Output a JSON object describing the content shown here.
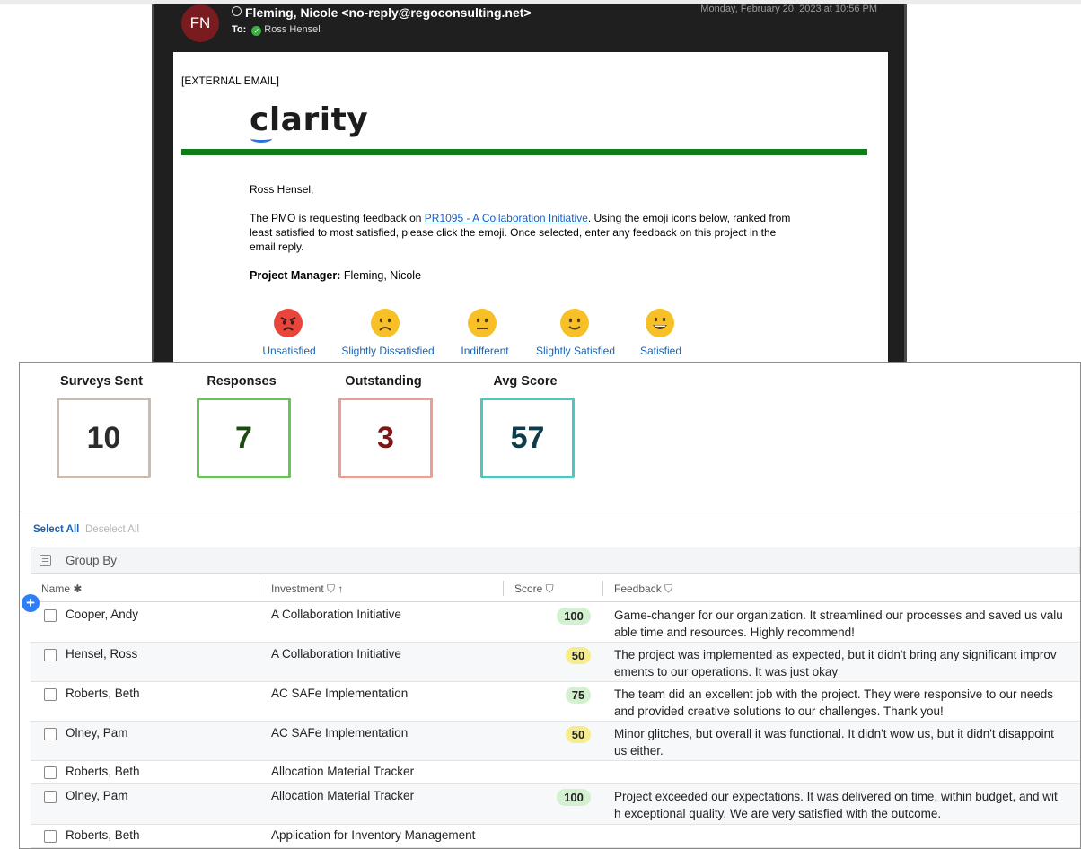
{
  "email": {
    "avatar_initials": "FN",
    "from": "Fleming, Nicole <no-reply@regoconsulting.net>",
    "to_label": "To:",
    "to_name": "Ross Hensel",
    "date": "Monday, February 20, 2023 at 10:56 PM",
    "external_tag": "[EXTERNAL EMAIL]",
    "logo_text": "clarity",
    "greeting": "Ross Hensel,",
    "body_pre": "The PMO is requesting feedback on ",
    "body_link": "PR1095 - A Collaboration Initiative",
    "body_post": ". Using the emoji icons below, ranked from least satisfied to most satisfied, please click the emoji. Once selected, enter any feedback on this project in the email reply.",
    "pm_label": "Project Manager:",
    "pm_value": " Fleming, Nicole",
    "emojis": [
      {
        "label": "Unsatisfied",
        "icon": "angry-face-icon",
        "color": "#e8453c"
      },
      {
        "label": "Slightly Dissatisfied",
        "icon": "frowning-face-icon",
        "color": "#f6c026"
      },
      {
        "label": "Indifferent",
        "icon": "neutral-face-icon",
        "color": "#f6c026"
      },
      {
        "label": "Slightly Satisfied",
        "icon": "slightly-smiling-face-icon",
        "color": "#f6c026"
      },
      {
        "label": "Satisfied",
        "icon": "grinning-face-icon",
        "color": "#f6c026"
      }
    ]
  },
  "kpis": [
    {
      "label": "Surveys Sent",
      "value": "10",
      "border": "#c9bcaf",
      "color": "#2b2b2b"
    },
    {
      "label": "Responses",
      "value": "7",
      "border": "#6cc25a",
      "color": "#1d4a12"
    },
    {
      "label": "Outstanding",
      "value": "3",
      "border": "#e8a096",
      "color": "#7d1616"
    },
    {
      "label": "Avg Score",
      "value": "57",
      "border": "#4fc7c0",
      "color": "#0e3c4a"
    }
  ],
  "grid": {
    "select_all": "Select All",
    "deselect_all": "Deselect All",
    "group_by": "Group By",
    "columns": {
      "name": "Name ✱",
      "investment": "Investment ⛉ ↑",
      "score": "Score ⛉",
      "feedback": "Feedback ⛉"
    },
    "rows": [
      {
        "name": "Cooper, Andy",
        "investment": "A Collaboration Initiative",
        "score": "100",
        "score_color": "#d3f0d1",
        "feedback": "Game-changer for our organization. It streamlined our processes and saved us valuable time and resources. Highly recommend!"
      },
      {
        "name": "Hensel, Ross",
        "investment": "A Collaboration Initiative",
        "score": "50",
        "score_color": "#f6ec8e",
        "feedback": "The project was implemented as expected, but it didn't bring any significant improvements to our operations. It was just okay"
      },
      {
        "name": "Roberts, Beth",
        "investment": "AC SAFe Implementation",
        "score": "75",
        "score_color": "#d3f0d1",
        "feedback": "The team did an excellent job with the project. They were responsive to our needs and provided creative solutions to our challenges. Thank you!"
      },
      {
        "name": "Olney, Pam",
        "investment": "AC SAFe Implementation",
        "score": "50",
        "score_color": "#f6ec8e",
        "feedback": "Minor glitches, but overall it was functional. It didn't wow us, but it didn't disappoint us either."
      },
      {
        "name": "Roberts, Beth",
        "investment": "Allocation Material Tracker",
        "score": "",
        "score_color": "",
        "feedback": ""
      },
      {
        "name": "Olney, Pam",
        "investment": "Allocation Material Tracker",
        "score": "100",
        "score_color": "#d3f0d1",
        "feedback": "Project exceeded our expectations. It was delivered on time, within budget, and with exceptional quality. We are very satisfied with the outcome."
      },
      {
        "name": "Roberts, Beth",
        "investment": "Application for Inventory Management",
        "score": "",
        "score_color": "",
        "feedback": ""
      }
    ]
  }
}
